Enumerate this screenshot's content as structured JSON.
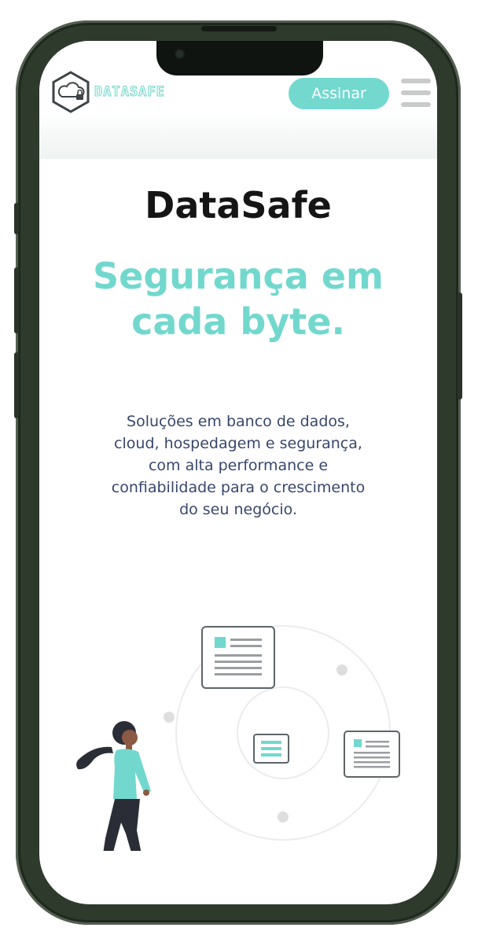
{
  "header": {
    "logo_text": "DATASAFE",
    "signup_label": "Assinar",
    "menu_icon": "hamburger-menu-icon",
    "logo_icon": "cloud-lock-hexagon-icon"
  },
  "hero": {
    "brand": "DataSafe",
    "tagline_line1": "Segurança em",
    "tagline_line2": "cada byte.",
    "description_lines": [
      "Soluções em banco de dados,",
      "cloud, hospedagem e segurança,",
      "com alta performance e",
      "confiabilidade para o crescimento",
      "do seu negócio."
    ]
  },
  "colors": {
    "accent": "#72d8ce",
    "heading": "#151515",
    "body_text": "#37476b",
    "frame": "#2e3a2c"
  },
  "illustration": {
    "icon": "woman-with-document-cards-illustration"
  }
}
